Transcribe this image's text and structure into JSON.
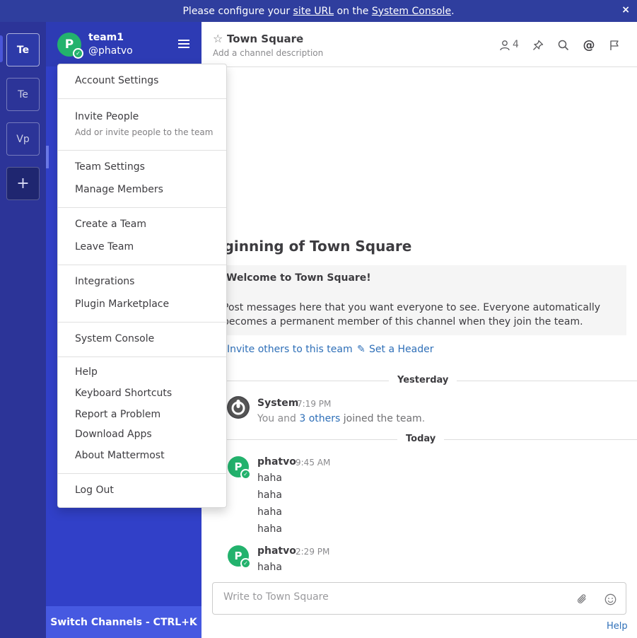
{
  "banner": {
    "prefix": "Please configure your ",
    "link1": "site URL",
    "middle": " on the ",
    "link2": "System Console",
    "suffix": ".",
    "close_icon": "×"
  },
  "teams": [
    {
      "label": "Te",
      "active": true
    },
    {
      "label": "Te",
      "active": false
    },
    {
      "label": "Vp",
      "active": false
    }
  ],
  "add_team_label": "+",
  "sidebar": {
    "avatar_letter": "P",
    "team_name": "team1",
    "username": "@phatvo",
    "switch_channels": "Switch Channels - CTRL+K"
  },
  "menu": {
    "account_settings": "Account Settings",
    "invite_people": "Invite People",
    "invite_people_sub": "Add or invite people to the team",
    "team_settings": "Team Settings",
    "manage_members": "Manage Members",
    "create_team": "Create a Team",
    "leave_team": "Leave Team",
    "integrations": "Integrations",
    "plugin_marketplace": "Plugin Marketplace",
    "system_console": "System Console",
    "help": "Help",
    "keyboard_shortcuts": "Keyboard Shortcuts",
    "report_problem": "Report a Problem",
    "download_apps": "Download Apps",
    "about": "About Mattermost",
    "log_out": "Log Out"
  },
  "channel": {
    "name": "Town Square",
    "description": "Add a channel description",
    "member_count": "4"
  },
  "intro": {
    "title": "eginning of Town Square",
    "welcome": "Welcome to Town Square!",
    "body": "Post messages here that you want everyone to see. Everyone automatically becomes a permanent member of this channel when they join the team.",
    "invite_link": "Invite others to this team",
    "header_link": "Set a Header"
  },
  "dates": {
    "yesterday": "Yesterday",
    "today": "Today"
  },
  "system_post": {
    "user": "System",
    "time": "7:19 PM",
    "text_prefix": "You and ",
    "text_link": "3 others",
    "text_suffix": " joined the team",
    "text_end": "."
  },
  "posts": [
    {
      "user": "phatvo",
      "time": "9:45 AM",
      "lines": [
        "haha",
        "haha",
        "haha",
        "haha"
      ]
    },
    {
      "user": "phatvo",
      "time": "2:29 PM",
      "lines": [
        "haha"
      ]
    }
  ],
  "composer": {
    "placeholder": "Write to Town Square"
  },
  "help_label": "Help",
  "colors": {
    "sidebar": "#3140c8",
    "team_sidebar": "#2c3498",
    "banner": "#2f3e9e",
    "avatar": "#23b26d",
    "link": "#2e6fb8"
  }
}
